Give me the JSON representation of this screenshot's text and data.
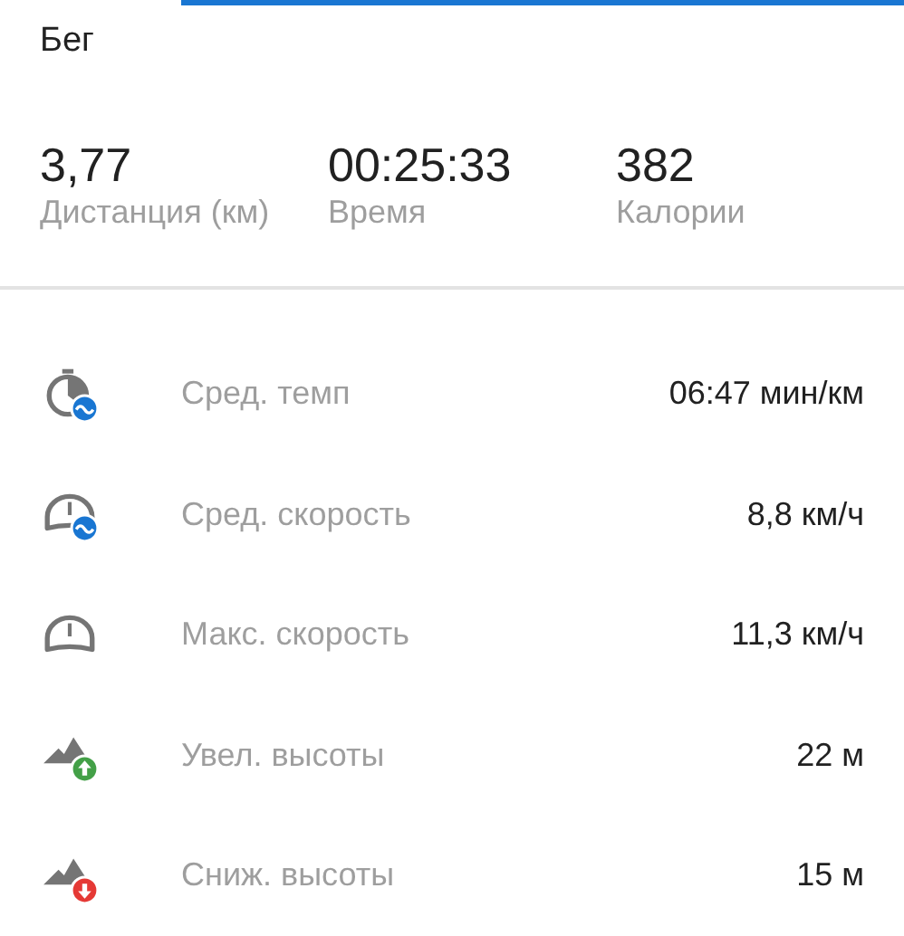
{
  "title": "Бег",
  "summary": [
    {
      "value": "3,77",
      "label": "Дистанция (км)"
    },
    {
      "value": "00:25:33",
      "label": "Время"
    },
    {
      "value": "382",
      "label": "Калории"
    }
  ],
  "metrics": [
    {
      "kind": "pace",
      "label": "Сред. темп",
      "value": "06:47 мин/км"
    },
    {
      "kind": "avgspeed",
      "label": "Сред. скорость",
      "value": "8,8 км/ч"
    },
    {
      "kind": "maxspeed",
      "label": "Макс. скорость",
      "value": "11,3 км/ч"
    },
    {
      "kind": "ascent",
      "label": "Увел. высоты",
      "value": "22 м"
    },
    {
      "kind": "descent",
      "label": "Сниж. высоты",
      "value": "15 м"
    }
  ]
}
